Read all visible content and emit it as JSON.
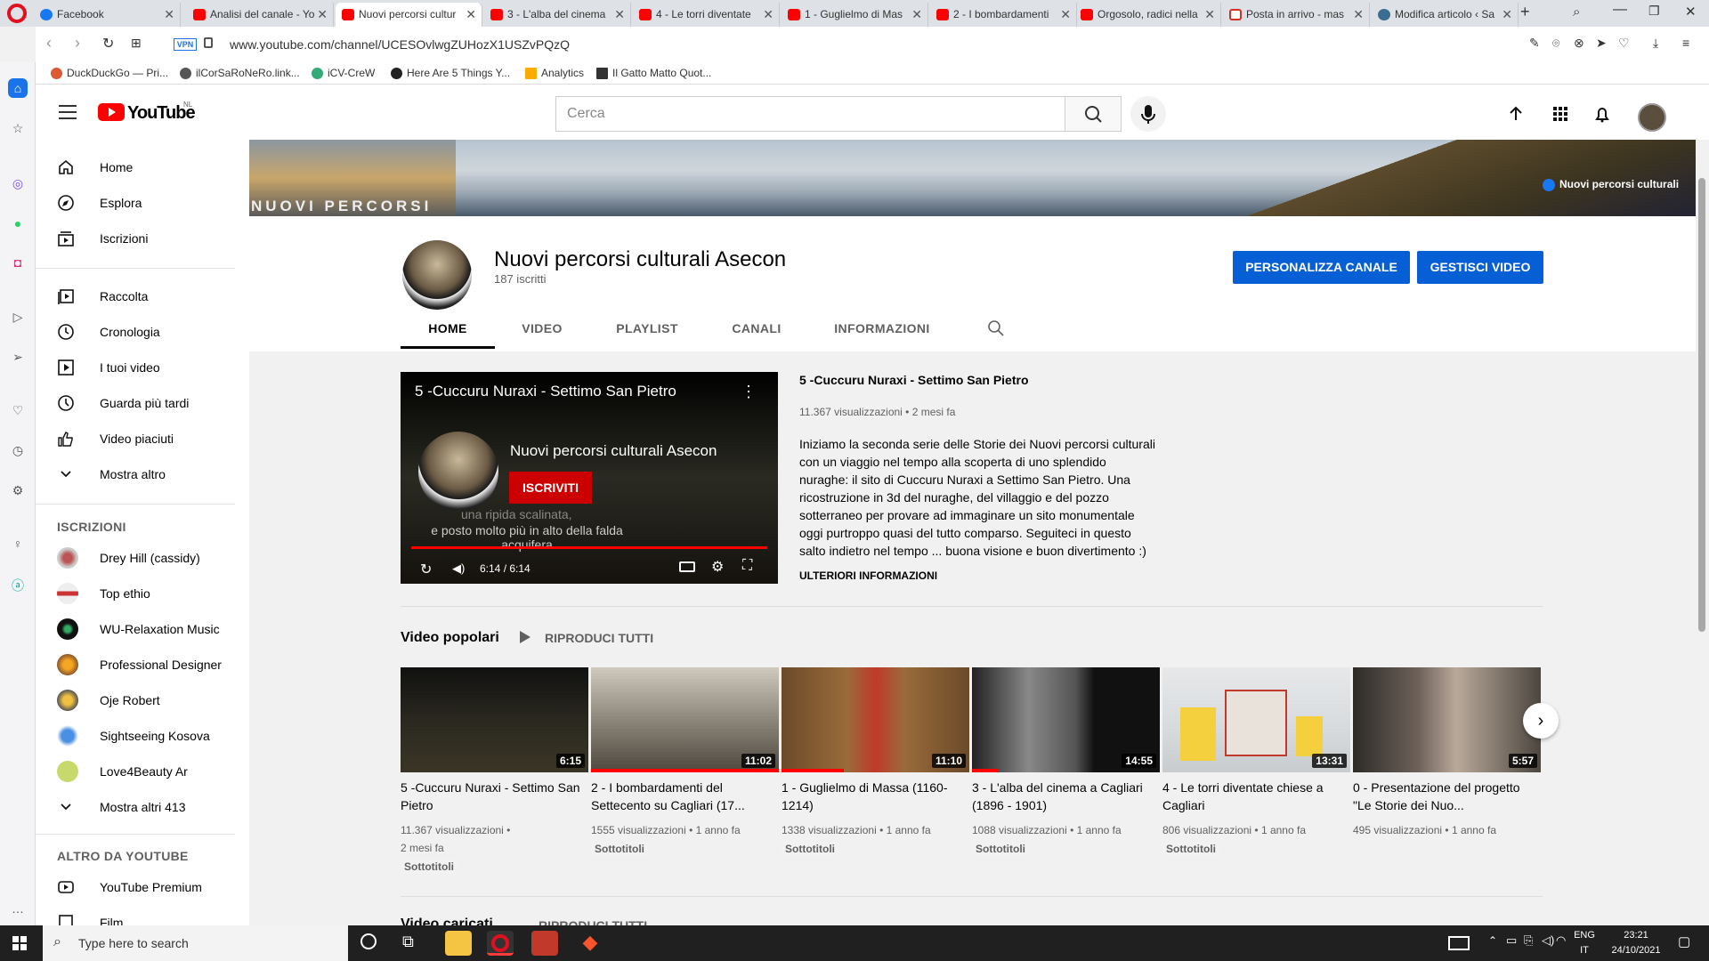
{
  "browser": {
    "tabs": [
      {
        "label": "Facebook",
        "favicon": "fb"
      },
      {
        "label": "Analisi del canale - Yo",
        "favicon": "yt"
      },
      {
        "label": "Nuovi percorsi cultur",
        "favicon": "yt",
        "active": true
      },
      {
        "label": "3 - L'alba del cinema",
        "favicon": "yt"
      },
      {
        "label": "4 - Le torri diventate",
        "favicon": "yt"
      },
      {
        "label": "1 - Guglielmo di Mas",
        "favicon": "yt"
      },
      {
        "label": "2 - I bombardamenti",
        "favicon": "yt"
      },
      {
        "label": "Orgosolo, radici nella",
        "favicon": "yt"
      },
      {
        "label": "Posta in arrivo - mas",
        "favicon": "gm"
      },
      {
        "label": "Modifica articolo ‹ Sa",
        "favicon": "wp"
      }
    ],
    "vpn_label": "VPN",
    "url": "www.youtube.com/channel/UCESOvlwgZUHozX1USZvPQzQ",
    "bookmarks": [
      "DuckDuckGo — Pri...",
      "ilCorSaRoNeRo.link...",
      "iCV-CreW",
      "Here Are 5 Things Y...",
      "Analytics",
      "Il Gatto Matto Quot..."
    ]
  },
  "header": {
    "logo_text": "YouTube",
    "region": "NL",
    "search_placeholder": "Cerca"
  },
  "sidebar": {
    "main": [
      "Home",
      "Esplora",
      "Iscrizioni"
    ],
    "library": [
      "Raccolta",
      "Cronologia",
      "I tuoi video",
      "Guarda più tardi",
      "Video piaciuti",
      "Mostra altro"
    ],
    "subs_heading": "ISCRIZIONI",
    "subs": [
      "Drey Hill (cassidy)",
      "Top ethio",
      "WU-Relaxation Music",
      "Professional Designer",
      "Oje Robert",
      "Sightseeing Kosova",
      "Love4Beauty Ar",
      "Mostra altri 413"
    ],
    "more_heading": "ALTRO DA YOUTUBE",
    "more": [
      "YouTube Premium",
      "Film"
    ]
  },
  "banner": {
    "left_text": "NUOVI PERCORSI",
    "fb_text": "Nuovi percorsi culturali"
  },
  "channel": {
    "name": "Nuovi percorsi culturali Asecon",
    "subscribers": "187 iscritti",
    "customize": "PERSONALIZZA CANALE",
    "manage": "GESTISCI VIDEO",
    "tabs": [
      "HOME",
      "VIDEO",
      "PLAYLIST",
      "CANALI",
      "INFORMAZIONI"
    ]
  },
  "featured": {
    "overlay_title": "5 -Cuccuru Nuraxi - Settimo San Pietro",
    "overlay_channel": "Nuovi percorsi culturali Asecon",
    "subscribe": "ISCRIVITI",
    "caption1": "una ripida scalinata,",
    "caption2": "e posto molto più in alto della falda acquifera",
    "time": "6:14 / 6:14",
    "title": "5 -Cuccuru Nuraxi - Settimo San Pietro",
    "meta": "11.367 visualizzazioni • 2 mesi fa",
    "description": "Iniziamo la seconda serie delle Storie dei Nuovi percorsi culturali con un viaggio nel tempo alla scoperta di uno splendido nuraghe: il sito di Cuccuru Nuraxi a Settimo San Pietro. Una ricostruzione in 3d del nuraghe, del villaggio e del pozzo sotterraneo per provare ad immaginare un sito monumentale oggi purtroppo quasi del tutto comparso. Seguiteci in questo salto indietro nel tempo ... buona visione e buon divertimento :)",
    "more": "ULTERIORI INFORMAZIONI"
  },
  "shelf": {
    "title": "Video popolari",
    "play_all": "RIPRODUCI TUTTI",
    "videos": [
      {
        "title": "5 -Cuccuru Nuraxi - Settimo San Pietro",
        "views": "11.367 visualizzazioni •",
        "age": "2 mesi fa",
        "duration": "6:15",
        "badge": "Sottotitoli"
      },
      {
        "title": "2 - I bombardamenti del Settecento su Cagliari (17...",
        "views": "1555 visualizzazioni",
        "age": "• 1 anno fa",
        "duration": "11:02",
        "badge": "Sottotitoli"
      },
      {
        "title": "1 - Guglielmo di Massa (1160-1214)",
        "views": "1338 visualizzazioni",
        "age": "• 1 anno fa",
        "duration": "11:10",
        "badge": "Sottotitoli"
      },
      {
        "title": "3 - L'alba del cinema a Cagliari (1896 - 1901)",
        "views": "1088 visualizzazioni",
        "age": "• 1 anno fa",
        "duration": "14:55",
        "badge": "Sottotitoli"
      },
      {
        "title": "4 - Le torri diventate chiese a Cagliari",
        "views": "806 visualizzazioni",
        "age": "• 1 anno fa",
        "duration": "13:31",
        "badge": "Sottotitoli"
      },
      {
        "title": "0 - Presentazione del progetto \"Le Storie dei Nuo...",
        "views": "495 visualizzazioni",
        "age": "• 1 anno fa",
        "duration": "5:57",
        "badge": ""
      }
    ]
  },
  "shelf2": {
    "title": "Video caricati",
    "play_all": "RIPRODUCI TUTTI"
  },
  "taskbar": {
    "search_placeholder": "Type here to search",
    "lang1": "ENG",
    "lang2": "IT",
    "time": "23:21",
    "date": "24/10/2021"
  }
}
